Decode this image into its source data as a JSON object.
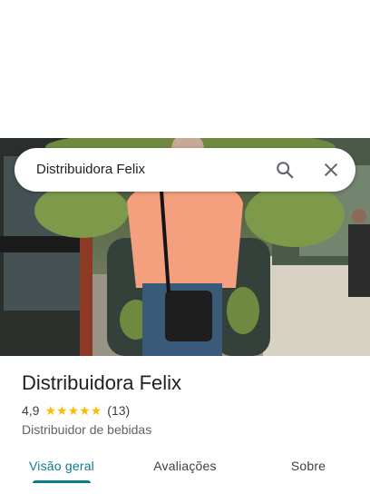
{
  "search": {
    "query": "Distribuidora Felix"
  },
  "place": {
    "name": "Distribuidora Felix",
    "rating": "4,9",
    "stars": 5,
    "review_count": "(13)",
    "category": "Distribuidor de bebidas"
  },
  "tabs": [
    {
      "label": "Visão geral",
      "active": true
    },
    {
      "label": "Avaliações",
      "active": false
    },
    {
      "label": "Sobre",
      "active": false
    }
  ],
  "icons": {
    "search": "search-icon",
    "close": "close-icon",
    "star": "star-icon"
  },
  "colors": {
    "accent": "#0b7c8f",
    "star": "#fbbc04"
  }
}
